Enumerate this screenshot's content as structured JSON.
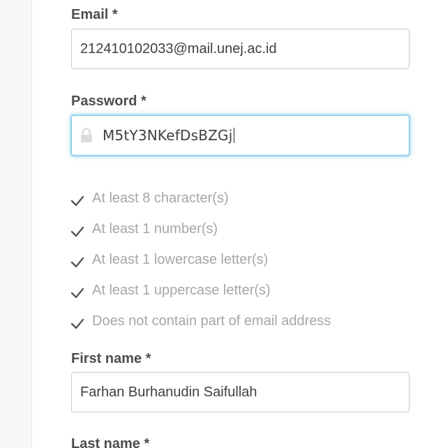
{
  "form": {
    "email": {
      "label": "Email *",
      "value": "212410102033@mail.unej.ac.id"
    },
    "password": {
      "label": "Password *",
      "value": "M5tY3NKefDsBZGj",
      "icon": "lock-icon"
    },
    "password_rules": [
      {
        "text": "At least 8 character(s)",
        "icon": "check-icon",
        "satisfied": true
      },
      {
        "text": "At least 1 number(s)",
        "icon": "check-icon",
        "satisfied": true
      },
      {
        "text": "At least 1 lowercase letter(s)",
        "icon": "check-icon",
        "satisfied": true
      },
      {
        "text": "At least 1 uppercase letter(s)",
        "icon": "check-icon",
        "satisfied": true
      },
      {
        "text": "Does not contain part of email address",
        "icon": "check-icon",
        "satisfied": true
      }
    ],
    "first_name": {
      "label": "First name *",
      "value": "Farhan Burhanudin Saifullah"
    },
    "last_name": {
      "label": "Last name *"
    }
  },
  "colors": {
    "label": "#4d4d4d",
    "rule_text": "#a6a6a6",
    "focus_border": "#7cc8e6",
    "input_border": "#c8c8c8"
  }
}
